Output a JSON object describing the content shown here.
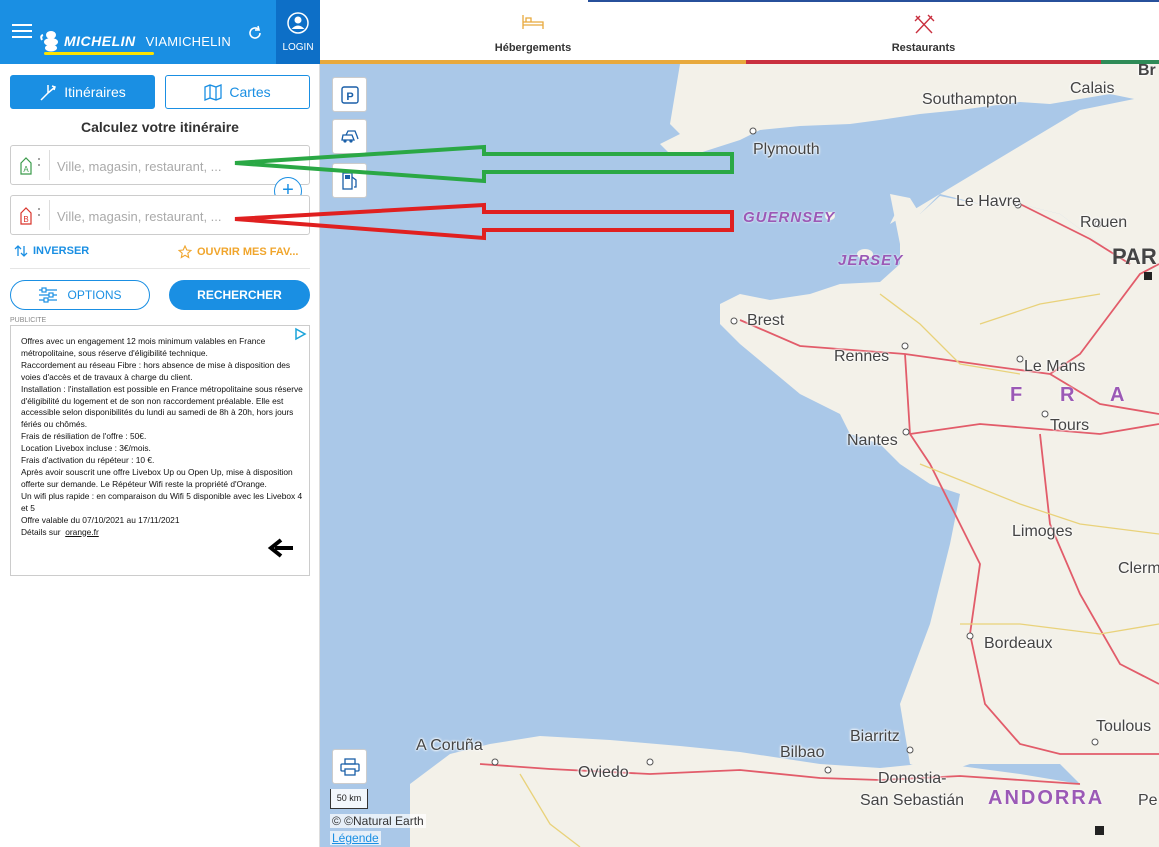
{
  "header": {
    "brand": "MICHELIN",
    "sub_brand": "VIAMICHELIN",
    "login_label": "LOGIN"
  },
  "top_tabs": {
    "hotels_label": "Hébergements",
    "restaurants_label": "Restaurants"
  },
  "sidebar": {
    "tab_itineraries": "Itinéraires",
    "tab_maps": "Cartes",
    "calc_title": "Calculez votre itinéraire",
    "from_placeholder": "Ville, magasin, restaurant, ...",
    "to_placeholder": "Ville, magasin, restaurant, ...",
    "from_letter": "A",
    "to_letter": "B",
    "invert_label": "INVERSER",
    "favorites_label": "OUVRIR MES FAV...",
    "options_label": "OPTIONS",
    "search_label": "RECHERCHER",
    "pub_label": "PUBLICITE"
  },
  "ad": {
    "lines": [
      "Offres avec un engagement 12 mois minimum valables en France métropolitaine, sous réserve d'éligibilité technique.",
      "Raccordement au réseau Fibre : hors absence de mise à disposition des voies d'accès et de travaux à charge du client.",
      "Installation : l'installation est possible en France métropolitaine sous réserve d'éligibilité du logement et de son non raccordement préalable. Elle est accessible selon disponibilités du lundi au samedi de 8h à 20h, hors jours fériés ou chômés.",
      "Frais de résiliation de l'offre : 50€.",
      "Location Livebox incluse : 3€/mois.",
      "Frais d'activation du répéteur : 10 €.",
      "Après avoir souscrit une offre Livebox Up ou Open Up, mise à disposition offerte sur demande. Le Répéteur Wifi reste la propriété d'Orange.",
      "Un wifi plus rapide : en comparaison du Wifi 5 disponible avec les Livebox 4 et 5",
      "Offre valable du 07/10/2021 au 17/11/2021"
    ],
    "details_prefix": "Détails sur",
    "details_link": "orange.fr"
  },
  "map": {
    "scale_label": "50 km",
    "attribution": "© ©Natural Earth",
    "legend_link": "Légende",
    "cities": [
      {
        "name": "Southampton"
      },
      {
        "name": "Calais"
      },
      {
        "name": "Plymouth"
      },
      {
        "name": "Le Havre"
      },
      {
        "name": "Rouen"
      },
      {
        "name": "Brest"
      },
      {
        "name": "Rennes"
      },
      {
        "name": "Le Mans"
      },
      {
        "name": "Tours"
      },
      {
        "name": "Nantes"
      },
      {
        "name": "Limoges"
      },
      {
        "name": "Clerm"
      },
      {
        "name": "Bordeaux"
      },
      {
        "name": "Toulous"
      },
      {
        "name": "A Coruña"
      },
      {
        "name": "Oviedo"
      },
      {
        "name": "Bilbao"
      },
      {
        "name": "Biarritz"
      },
      {
        "name": "Donostia-"
      },
      {
        "name": "San Sebastián"
      },
      {
        "name": "Pe"
      },
      {
        "name": "Br"
      }
    ],
    "islands": [
      "GUERNSEY",
      "JERSEY"
    ],
    "country_label": "ANDORRA",
    "france_letters": [
      "F",
      "R",
      "A"
    ],
    "paris_label": "PAR"
  },
  "colors": {
    "primary": "#1a8fe3",
    "hotel": "#e8a93c",
    "restaurant": "#c9303f",
    "green_arrow": "#2aa845",
    "red_arrow": "#e02020",
    "sea": "#aac8e8",
    "land": "#f3f1e9"
  }
}
